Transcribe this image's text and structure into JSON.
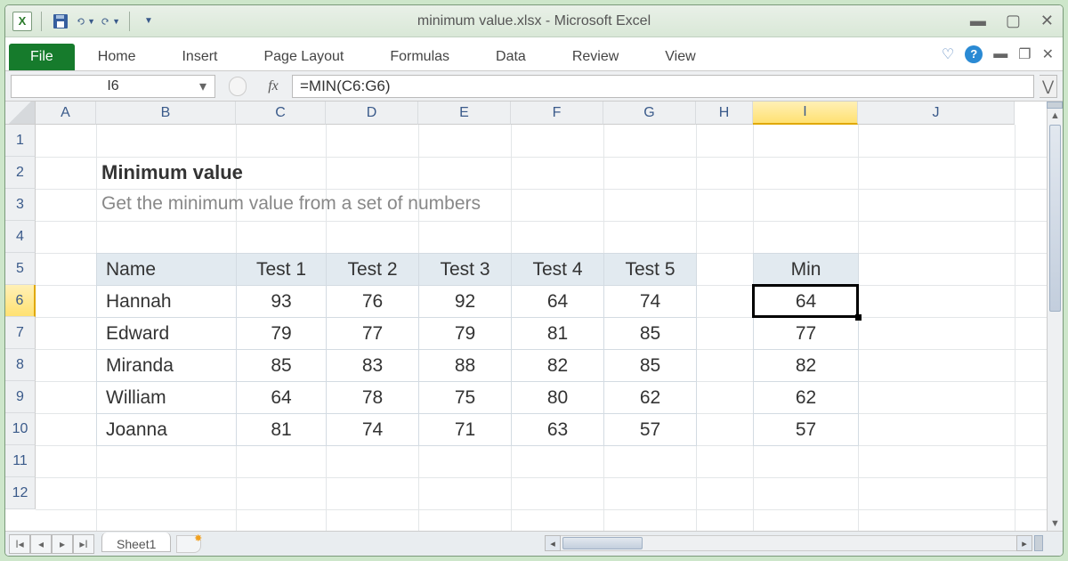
{
  "window": {
    "title": "minimum value.xlsx - Microsoft Excel"
  },
  "qat": {
    "app_letter": "X"
  },
  "ribbon": {
    "file": "File",
    "tabs": [
      "Home",
      "Insert",
      "Page Layout",
      "Formulas",
      "Data",
      "Review",
      "View"
    ]
  },
  "formula_bar": {
    "name_box": "I6",
    "fx_label": "fx",
    "formula": "=MIN(C6:G6)"
  },
  "columns": [
    {
      "letter": "A",
      "w": 68
    },
    {
      "letter": "B",
      "w": 157
    },
    {
      "letter": "C",
      "w": 101
    },
    {
      "letter": "D",
      "w": 104
    },
    {
      "letter": "E",
      "w": 104
    },
    {
      "letter": "F",
      "w": 104
    },
    {
      "letter": "G",
      "w": 104
    },
    {
      "letter": "H",
      "w": 64
    },
    {
      "letter": "I",
      "w": 118
    },
    {
      "letter": "J",
      "w": 176
    }
  ],
  "rows": [
    1,
    2,
    3,
    4,
    5,
    6,
    7,
    8,
    9,
    10,
    11,
    12
  ],
  "content": {
    "title": "Minimum value",
    "subtitle": "Get the minimum value from a set of numbers"
  },
  "table": {
    "headers": [
      "Name",
      "Test 1",
      "Test 2",
      "Test 3",
      "Test 4",
      "Test 5"
    ],
    "rows": [
      {
        "name": "Hannah",
        "vals": [
          93,
          76,
          92,
          64,
          74
        ]
      },
      {
        "name": "Edward",
        "vals": [
          79,
          77,
          79,
          81,
          85
        ]
      },
      {
        "name": "Miranda",
        "vals": [
          85,
          83,
          88,
          82,
          85
        ]
      },
      {
        "name": "William",
        "vals": [
          64,
          78,
          75,
          80,
          62
        ]
      },
      {
        "name": "Joanna",
        "vals": [
          81,
          74,
          71,
          63,
          57
        ]
      }
    ]
  },
  "min_table": {
    "header": "Min",
    "vals": [
      64,
      77,
      82,
      62,
      57
    ]
  },
  "active_cell": "I6",
  "sheets": {
    "active": "Sheet1"
  }
}
